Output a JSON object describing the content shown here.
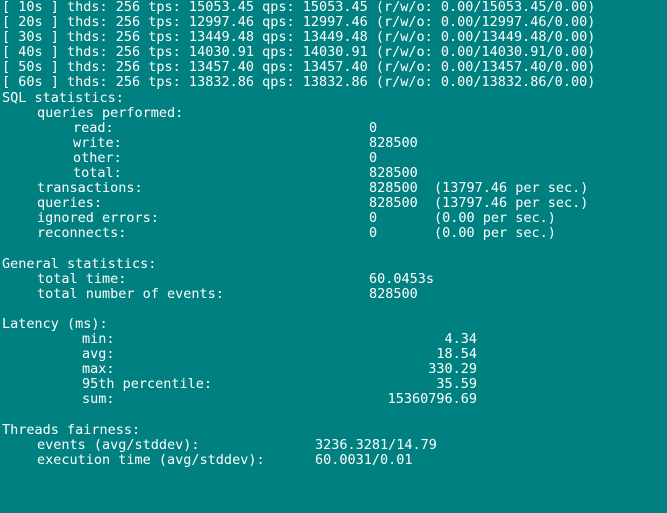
{
  "progress_lines": [
    "[ 10s ] thds: 256 tps: 15053.45 qps: 15053.45 (r/w/o: 0.00/15053.45/0.00)",
    "[ 20s ] thds: 256 tps: 12997.46 qps: 12997.46 (r/w/o: 0.00/12997.46/0.00)",
    "[ 30s ] thds: 256 tps: 13449.48 qps: 13449.48 (r/w/o: 0.00/13449.48/0.00)",
    "[ 40s ] thds: 256 tps: 14030.91 qps: 14030.91 (r/w/o: 0.00/14030.91/0.00)",
    "[ 50s ] thds: 256 tps: 13457.40 qps: 13457.40 (r/w/o: 0.00/13457.40/0.00)",
    "[ 60s ] thds: 256 tps: 13832.86 qps: 13832.86 (r/w/o: 0.00/13832.86/0.00)"
  ],
  "sql_statistics": {
    "heading": "SQL statistics:",
    "queries_performed": {
      "label": "queries performed:",
      "read": {
        "label": "read:",
        "value": "0"
      },
      "write": {
        "label": "write:",
        "value": "828500"
      },
      "other": {
        "label": "other:",
        "value": "0"
      },
      "total": {
        "label": "total:",
        "value": "828500"
      }
    },
    "transactions": {
      "label": "transactions:",
      "value": "828500",
      "extra": "(13797.46 per sec.)"
    },
    "queries": {
      "label": "queries:",
      "value": "828500",
      "extra": "(13797.46 per sec.)"
    },
    "ignored_errors": {
      "label": "ignored errors:",
      "value": "0",
      "extra": "(0.00 per sec.)"
    },
    "reconnects": {
      "label": "reconnects:",
      "value": "0",
      "extra": "(0.00 per sec.)"
    }
  },
  "general_statistics": {
    "heading": "General statistics:",
    "total_time": {
      "label": "total time:",
      "value": "60.0453s"
    },
    "total_events": {
      "label": "total number of events:",
      "value": "828500"
    }
  },
  "latency": {
    "heading": "Latency (ms):",
    "min": {
      "label": "min:",
      "value": "4.34"
    },
    "avg": {
      "label": "avg:",
      "value": "18.54"
    },
    "max": {
      "label": "max:",
      "value": "330.29"
    },
    "p95": {
      "label": "95th percentile:",
      "value": "35.59"
    },
    "sum": {
      "label": "sum:",
      "value": "15360796.69"
    }
  },
  "threads_fairness": {
    "heading": "Threads fairness:",
    "events": {
      "label": "events (avg/stddev):",
      "value": "3236.3281/14.79"
    },
    "execution_time": {
      "label": "execution time (avg/stddev):",
      "value": "60.0031/0.01"
    }
  }
}
